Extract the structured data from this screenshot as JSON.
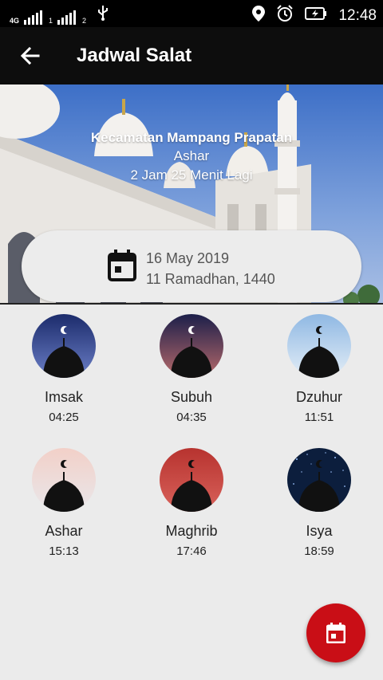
{
  "status_bar": {
    "network_label": "4G",
    "sim1": "1",
    "sim2": "2",
    "time": "12:48",
    "icons": [
      "signal-icon",
      "usb-icon",
      "location-icon",
      "alarm-icon",
      "battery-charging-icon"
    ]
  },
  "app_bar": {
    "title": "Jadwal Salat",
    "back_icon": "arrow-left-icon"
  },
  "header": {
    "location": "Kecamatan Mampang Prapatan",
    "next_prayer": "Ashar",
    "countdown": "2 Jam 25 Menit Lagi"
  },
  "date_card": {
    "icon": "calendar-icon",
    "gregorian": "16 May 2019",
    "hijri": "11 Ramadhan, 1440"
  },
  "prayers": [
    {
      "name": "Imsak",
      "time": "04:25"
    },
    {
      "name": "Subuh",
      "time": "04:35"
    },
    {
      "name": "Dzuhur",
      "time": "11:51"
    },
    {
      "name": "Ashar",
      "time": "15:13"
    },
    {
      "name": "Maghrib",
      "time": "17:46"
    },
    {
      "name": "Isya",
      "time": "18:59"
    }
  ],
  "fab": {
    "icon": "calendar-icon"
  },
  "colors": {
    "accent": "#c90e16",
    "app_bar": "#0d0d0d"
  }
}
